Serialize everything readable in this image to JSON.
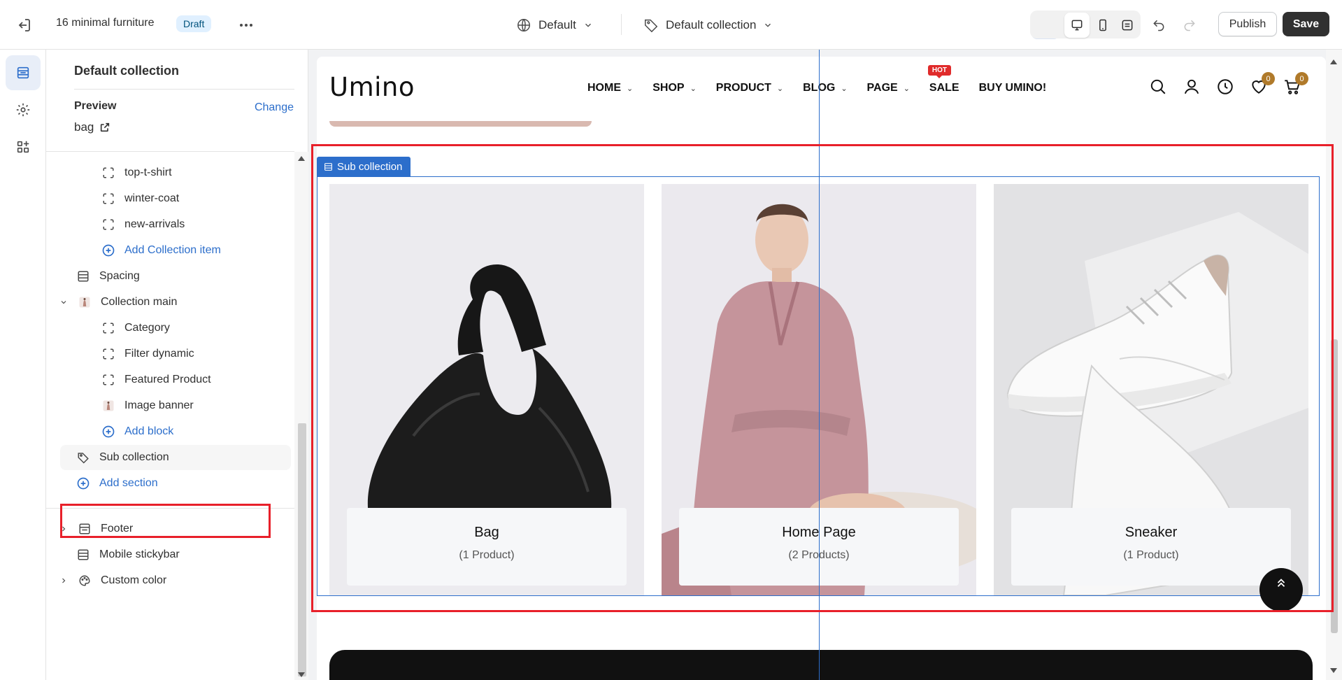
{
  "topbar": {
    "store_title": "16 minimal furniture",
    "status_badge": "Draft",
    "locale_label": "Default",
    "template_label": "Default collection",
    "publish_label": "Publish",
    "save_label": "Save"
  },
  "sidebar": {
    "heading": "Default collection",
    "preview_label": "Preview",
    "change_label": "Change",
    "preview_value": "bag",
    "items": [
      {
        "label": "top-t-shirt",
        "icon": "block-dashed-icon"
      },
      {
        "label": "winter-coat",
        "icon": "block-dashed-icon"
      },
      {
        "label": "new-arrivals",
        "icon": "block-dashed-icon"
      },
      {
        "label": "Add Collection item",
        "icon": "plus-circle-icon"
      },
      {
        "label": "Spacing",
        "icon": "section-icon"
      },
      {
        "label": "Collection main",
        "icon": "image-thumb-icon"
      },
      {
        "label": "Category",
        "icon": "block-dashed-icon"
      },
      {
        "label": "Filter dynamic",
        "icon": "block-dashed-icon"
      },
      {
        "label": "Featured Product",
        "icon": "block-dashed-icon"
      },
      {
        "label": "Image banner",
        "icon": "image-thumb-icon"
      },
      {
        "label": "Add block",
        "icon": "plus-circle-icon"
      },
      {
        "label": "Sub collection",
        "icon": "tag-icon"
      },
      {
        "label": "Add section",
        "icon": "plus-circle-icon"
      },
      {
        "label": "Footer",
        "icon": "section-icon"
      },
      {
        "label": "Mobile stickybar",
        "icon": "section-icon"
      },
      {
        "label": "Custom color",
        "icon": "palette-icon"
      }
    ]
  },
  "store": {
    "logo": "Umino",
    "nav": [
      {
        "label": "HOME",
        "has_dropdown": true
      },
      {
        "label": "SHOP",
        "has_dropdown": true
      },
      {
        "label": "PRODUCT",
        "has_dropdown": true
      },
      {
        "label": "BLOG",
        "has_dropdown": true
      },
      {
        "label": "PAGE",
        "has_dropdown": true
      },
      {
        "label": "SALE",
        "has_dropdown": false
      },
      {
        "label": "BUY UMINO!",
        "has_dropdown": false
      }
    ],
    "hot_badge": "HOT",
    "wishlist_count": "0",
    "cart_count": "0",
    "section_label": "Sub collection",
    "collections": [
      {
        "name": "Bag",
        "count": "(1 Product)"
      },
      {
        "name": "Home Page",
        "count": "(2 Products)"
      },
      {
        "name": "Sneaker",
        "count": "(1 Product)"
      }
    ]
  },
  "colors": {
    "accent": "#2c6ecb",
    "highlight": "#e8202a",
    "badge": "#b07a2a"
  }
}
